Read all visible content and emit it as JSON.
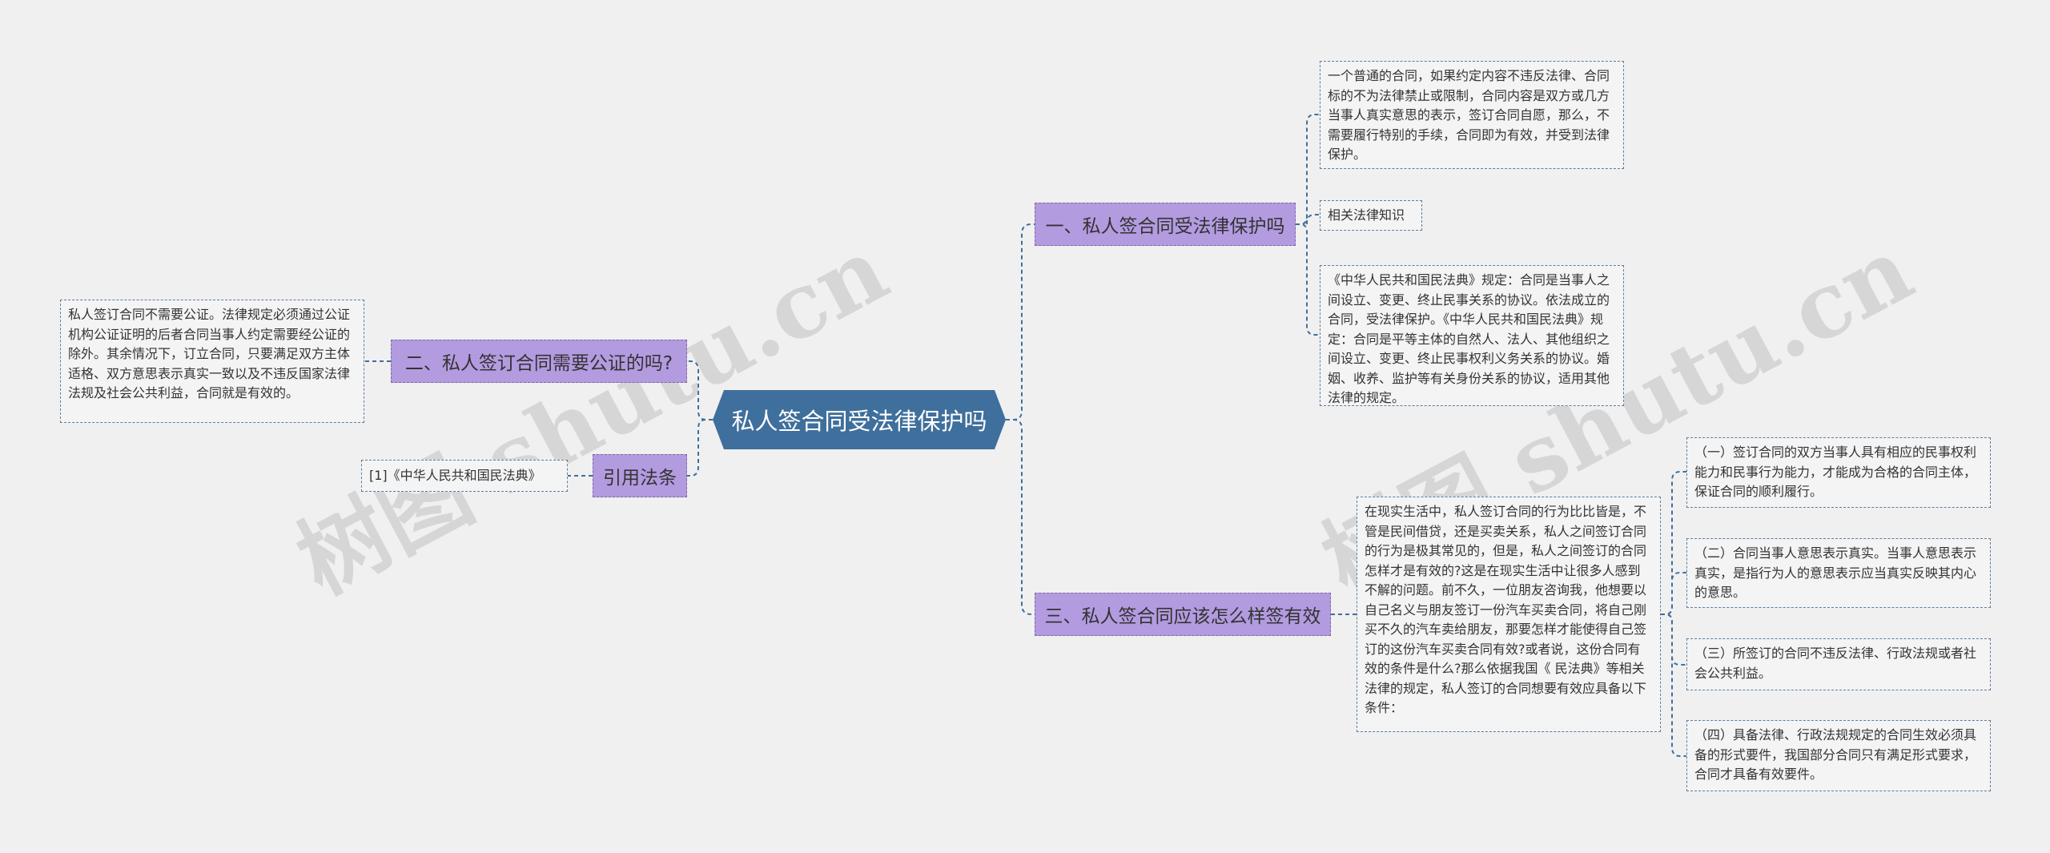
{
  "root": {
    "label": "私人签合同受法律保护吗"
  },
  "branches": {
    "b1": "一、私人签合同受法律保护吗",
    "b2": "二、私人签订合同需要公证的吗?",
    "b3": "三、私人签合同应该怎么样签有效",
    "b4": "引用法条"
  },
  "leaves": {
    "b1_1": "一个普通的合同，如果约定内容不违反法律、合同标的不为法律禁止或限制，合同内容是双方或几方当事人真实意思的表示，签订合同自愿，那么，不需要履行特别的手续，合同即为有效，并受到法律保护。",
    "b1_2": "相关法律知识",
    "b1_3": "《中华人民共和国民法典》规定：合同是当事人之间设立、变更、终止民事关系的协议。依法成立的合同，受法律保护。《中华人民共和国民法典》规定：合同是平等主体的自然人、法人、其他组织之间设立、变更、终止民事权利义务关系的协议。婚姻、收养、监护等有关身份关系的协议，适用其他法律的规定。",
    "b2_1": "私人签订合同不需要公证。法律规定必须通过公证机构公证证明的后者合同当事人约定需要经公证的除外。其余情况下，订立合同，只要满足双方主体适格、双方意思表示真实一致以及不违反国家法律法规及社会公共利益，合同就是有效的。",
    "b3_1": "在现实生活中，私人签订合同的行为比比皆是，不管是民间借贷，还是买卖关系，私人之间签订合同的行为是极其常见的，但是，私人之间签订的合同怎样才是有效的?这是在现实生活中让很多人感到不解的问题。前不久，一位朋友咨询我，他想要以自己名义与朋友签订一份汽车买卖合同，将自己刚买不久的汽车卖给朋友，那要怎样才能使得自己签订的这份汽车买卖合同有效?或者说，这份合同有效的条件是什么?那么依据我国《 民法典》等相关法律的规定，私人签订的合同想要有效应具备以下条件：",
    "b3_1_1": "（一）签订合同的双方当事人具有相应的民事权利能力和民事行为能力，才能成为合格的合同主体，保证合同的顺利履行。",
    "b3_1_2": "（二）合同当事人意思表示真实。当事人意思表示真实，是指行为人的意思表示应当真实反映其内心的意思。",
    "b3_1_3": "（三）所签订的合同不违反法律、行政法规或者社会公共利益。",
    "b3_1_4": "（四）具备法律、行政法规规定的合同生效必须具备的形式要件，我国部分合同只有满足形式要求，合同才具备有效要件。",
    "b4_1": "[1]《中华人民共和国民法典》"
  },
  "watermarks": [
    "树图 shutu.cn",
    "树图 shutu.cn"
  ],
  "colors": {
    "root_fill": "#3f6f9c",
    "branch_fill": "#b39be0",
    "leaf_border": "#5b7d9e",
    "edge": "#3f6f9c",
    "background": "#f0f0f0"
  }
}
